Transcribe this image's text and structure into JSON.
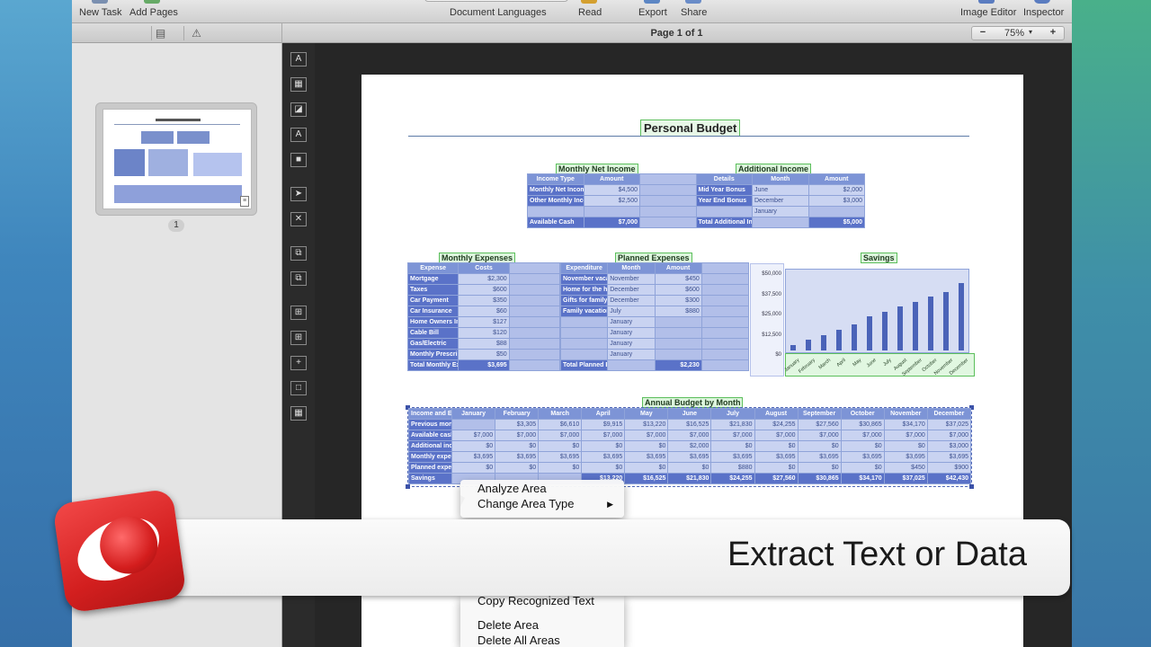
{
  "toolbar": {
    "new_task": "New Task",
    "add_pages": "Add Pages",
    "document_languages": "Document Languages",
    "read": "Read",
    "export": "Export",
    "share": "Share",
    "image_editor": "Image Editor",
    "inspector": "Inspector"
  },
  "secondbar": {
    "page_indicator": "Page 1 of 1",
    "zoom_minus": "−",
    "zoom_value": "75%",
    "zoom_plus": "+"
  },
  "sidebar": {
    "page_number": "1"
  },
  "tools": [
    {
      "icon": "text-area-icon",
      "glyph": "A"
    },
    {
      "icon": "table-area-icon",
      "glyph": "▦"
    },
    {
      "icon": "picture-area-icon",
      "glyph": "◪"
    },
    {
      "icon": "text-on-picture-icon",
      "glyph": "A"
    },
    {
      "icon": "background-picture-icon",
      "glyph": "■"
    },
    {
      "icon": "select-arrow-icon",
      "glyph": "➤"
    },
    {
      "icon": "delete-area-icon",
      "glyph": "✕"
    },
    {
      "icon": "add-area-icon",
      "glyph": "⧉"
    },
    {
      "icon": "subtract-area-icon",
      "glyph": "⧉"
    },
    {
      "icon": "insert-column-icon",
      "glyph": "⊞"
    },
    {
      "icon": "insert-row-icon",
      "glyph": "⊞"
    },
    {
      "icon": "split-cells-icon",
      "glyph": "+"
    },
    {
      "icon": "merge-cells-icon",
      "glyph": "□"
    },
    {
      "icon": "table-grid-icon",
      "glyph": "▦"
    }
  ],
  "document": {
    "title": "Personal Budget",
    "income": {
      "label_left": "Monthly Net Income",
      "label_right": "Additional Income",
      "headers": [
        "Income Type",
        "Amount",
        "",
        "Details",
        "Month",
        "Amount"
      ],
      "rows": [
        [
          "Monthly Net Income",
          "$4,500",
          "",
          "Mid Year Bonus",
          "June",
          "$2,000"
        ],
        [
          "Other Monthly Income",
          "$2,500",
          "",
          "Year End Bonus",
          "December",
          "$3,000"
        ],
        [
          "",
          "",
          "",
          "",
          "January",
          ""
        ],
        [
          "Available Cash",
          "$7,000",
          "",
          "Total Additional Income",
          "",
          "$5,000"
        ]
      ]
    },
    "expenses": {
      "label": "Monthly Expenses",
      "headers": [
        "Expense",
        "Costs",
        ""
      ],
      "rows": [
        [
          "Mortgage",
          "$2,300",
          ""
        ],
        [
          "Taxes",
          "$600",
          ""
        ],
        [
          "Car Payment",
          "$350",
          ""
        ],
        [
          "Car Insurance",
          "$60",
          ""
        ],
        [
          "Home Owners Insurance",
          "$127",
          ""
        ],
        [
          "Cable Bill",
          "$120",
          ""
        ],
        [
          "Gas/Electric",
          "$88",
          ""
        ],
        [
          "Monthly Prescription",
          "$50",
          ""
        ],
        [
          "Total Monthly Expenses",
          "$3,695",
          ""
        ]
      ]
    },
    "planned": {
      "label": "Planned Expenses",
      "headers": [
        "Expenditure",
        "Month",
        "Amount",
        ""
      ],
      "rows": [
        [
          "November vacation",
          "November",
          "$450",
          ""
        ],
        [
          "Home for the holidays",
          "December",
          "$600",
          ""
        ],
        [
          "Gifts for family",
          "December",
          "$300",
          ""
        ],
        [
          "Family vacation",
          "July",
          "$880",
          ""
        ],
        [
          "",
          "January",
          "",
          ""
        ],
        [
          "",
          "January",
          "",
          ""
        ],
        [
          "",
          "January",
          "",
          ""
        ],
        [
          "",
          "January",
          "",
          ""
        ],
        [
          "Total Planned Expenses",
          "",
          "$2,230",
          ""
        ]
      ]
    },
    "savings_label": "Savings",
    "annual": {
      "label": "Annual Budget by Month",
      "headers": [
        "Income and Expenses",
        "January",
        "February",
        "March",
        "April",
        "May",
        "June",
        "July",
        "August",
        "September",
        "October",
        "November",
        "December"
      ],
      "rows": [
        [
          "Previous month's balance",
          "",
          "$3,305",
          "$6,610",
          "$9,915",
          "$13,220",
          "$16,525",
          "$21,830",
          "$24,255",
          "$27,560",
          "$30,865",
          "$34,170",
          "$37,025"
        ],
        [
          "Available cash",
          "$7,000",
          "$7,000",
          "$7,000",
          "$7,000",
          "$7,000",
          "$7,000",
          "$7,000",
          "$7,000",
          "$7,000",
          "$7,000",
          "$7,000",
          "$7,000"
        ],
        [
          "Additional income",
          "$0",
          "$0",
          "$0",
          "$0",
          "$0",
          "$2,000",
          "$0",
          "$0",
          "$0",
          "$0",
          "$0",
          "$3,000"
        ],
        [
          "Monthly expenses",
          "$3,695",
          "$3,695",
          "$3,695",
          "$3,695",
          "$3,695",
          "$3,695",
          "$3,695",
          "$3,695",
          "$3,695",
          "$3,695",
          "$3,695",
          "$3,695"
        ],
        [
          "Planned expenses",
          "$0",
          "$0",
          "$0",
          "$0",
          "$0",
          "$0",
          "$880",
          "$0",
          "$0",
          "$0",
          "$450",
          "$900"
        ],
        [
          "Savings",
          "",
          "",
          "",
          "$13,220",
          "$16,525",
          "$21,830",
          "$24,255",
          "$27,560",
          "$30,865",
          "$34,170",
          "$37,025",
          "$42,430"
        ]
      ]
    }
  },
  "chart_data": {
    "type": "bar",
    "title": "Savings",
    "categories": [
      "January",
      "February",
      "March",
      "April",
      "May",
      "June",
      "July",
      "August",
      "September",
      "October",
      "November",
      "December"
    ],
    "values": [
      3305,
      6610,
      9915,
      13220,
      16525,
      21830,
      24255,
      27560,
      30865,
      34170,
      37025,
      42430
    ],
    "y_ticks": [
      "$50,000",
      "$37,500",
      "$25,000",
      "$12,500",
      "$0"
    ],
    "ylim": [
      0,
      50000
    ],
    "grid": false,
    "legend": "none"
  },
  "context_menu": {
    "items_top": [
      "Analyze Area",
      "Change Area Type"
    ],
    "items_bottom": [
      "Copy Recognized Text",
      "Delete Area",
      "Delete All Areas"
    ]
  },
  "banner": {
    "text": "Extract Text or Data"
  }
}
